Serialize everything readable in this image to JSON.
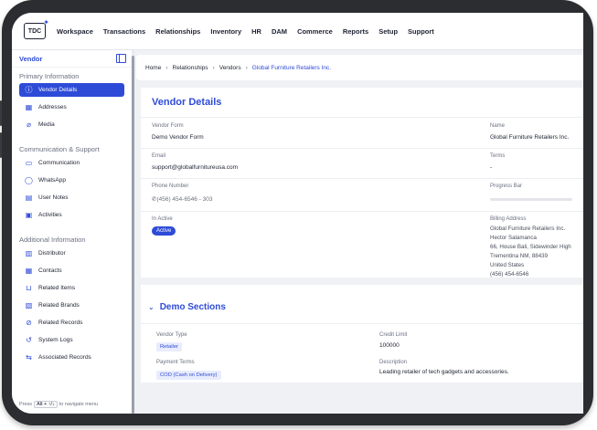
{
  "nav": {
    "logo": "TDC",
    "items": [
      "Workspace",
      "Transactions",
      "Relationships",
      "Inventory",
      "HR",
      "DAM",
      "Commerce",
      "Reports",
      "Setup",
      "Support"
    ]
  },
  "sidebar": {
    "title": "Vendor",
    "sections": [
      {
        "title": "Primary Information",
        "items": [
          {
            "label": "Vendor Details",
            "icon": "info-icon",
            "active": true
          },
          {
            "label": "Addresses",
            "icon": "map-icon"
          },
          {
            "label": "Media",
            "icon": "paperclip-icon"
          }
        ]
      },
      {
        "title": "Communication & Support",
        "items": [
          {
            "label": "Communication",
            "icon": "chat-icon"
          },
          {
            "label": "WhatsApp",
            "icon": "whatsapp-icon"
          },
          {
            "label": "User Notes",
            "icon": "note-icon"
          },
          {
            "label": "Activities",
            "icon": "activity-icon"
          }
        ]
      },
      {
        "title": "Additional Information",
        "items": [
          {
            "label": "Distributor",
            "icon": "distributor-icon"
          },
          {
            "label": "Contacts",
            "icon": "contacts-icon"
          },
          {
            "label": "Related Items",
            "icon": "cart-icon"
          },
          {
            "label": "Related Brands",
            "icon": "brand-icon"
          },
          {
            "label": "Related Records",
            "icon": "link-icon"
          },
          {
            "label": "System Logs",
            "icon": "history-icon"
          },
          {
            "label": "Associated Records",
            "icon": "associated-icon"
          }
        ]
      }
    ],
    "footer": {
      "prefix": "Press",
      "key1": "Alt + ↑/↓",
      "suffix": "to navigate menu"
    }
  },
  "breadcrumb": [
    "Home",
    "Relationships",
    "Vendors",
    "Global Furniture Retailers Inc."
  ],
  "details": {
    "title": "Vendor Details",
    "vendor_form_label": "Vendor Form",
    "vendor_form_value": "Demo Vendor Form",
    "name_label": "Name",
    "name_value": "Global Furniture Retailers Inc.",
    "email_label": "Email",
    "email_value": "support@globalfurnitureusa.com",
    "terms_label": "Terms",
    "terms_value": "-",
    "phone_label": "Phone Number",
    "phone_value": "(456) 454-6546 - 303",
    "progress_label": "Progress Bar",
    "progress_value": 0,
    "inactive_label": "In Active",
    "inactive_value": "Active",
    "billing_label": "Billing Address",
    "billing_lines": [
      "Global Furniture Retailers Inc.",
      "Hector Salamanca",
      "66, House Bali, Sidewinder High",
      "Trementina NM, 88439",
      "United States",
      "(456) 454-6546"
    ]
  },
  "demo": {
    "title": "Demo Sections",
    "vendor_type_label": "Vendor Type",
    "vendor_type_value": "Retailer",
    "credit_limit_label": "Credit Limit",
    "credit_limit_value": "100000",
    "payment_terms_label": "Payment Terms",
    "payment_terms_value": "COD (Cash on Delivery)",
    "description_label": "Description",
    "description_value": "Leading retailer of tech gadgets and accessories."
  },
  "colors": {
    "accent": "#2e4bd8",
    "device": "#2c2d31"
  }
}
